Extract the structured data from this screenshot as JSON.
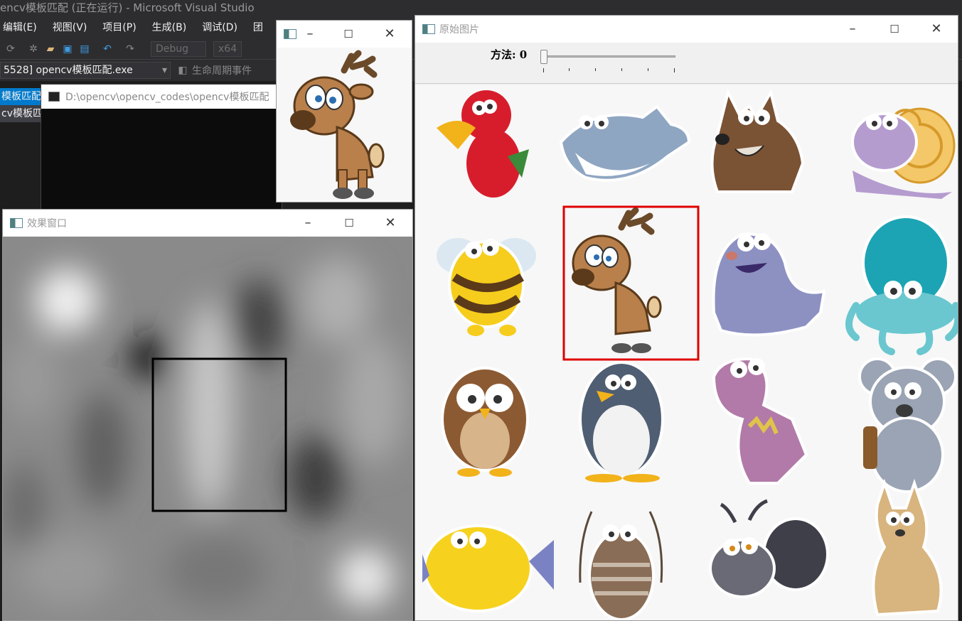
{
  "vs": {
    "title": "encv模板匹配 (正在运行) - Microsoft Visual Studio",
    "menu": [
      "编辑(E)",
      "视图(V)",
      "项目(P)",
      "生成(B)",
      "调试(D)",
      "团"
    ],
    "toolbar": {
      "config": "Debug",
      "platform": "x64"
    },
    "process": "5528] opencv模板匹配.exe",
    "lifecycle": "生命周期事件",
    "tabs": [
      "模板匹配.c",
      "cv模板匹配"
    ]
  },
  "console": {
    "title": "D:\\opencv\\opencv_codes\\opencv模板匹配"
  },
  "template_window": {
    "title": ""
  },
  "result_window": {
    "title": "效果窗口"
  },
  "original_window": {
    "title": "原始图片",
    "trackbar": {
      "label": "方法: 0",
      "value": 0,
      "min": 0,
      "max": 5
    }
  },
  "icons": {
    "minimize": "minimize-icon",
    "maximize": "maximize-icon",
    "close": "close-icon"
  },
  "colors": {
    "match_rect": "#e00000",
    "result_rect": "#000000",
    "vs_accent": "#007acc"
  }
}
